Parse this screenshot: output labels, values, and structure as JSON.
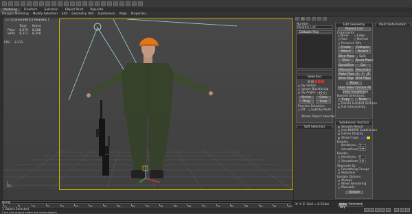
{
  "menubar": {
    "tabs": [
      "Modeling",
      "Freeform",
      "Selection",
      "Object Paint",
      "Populate"
    ],
    "active_tab": 0
  },
  "ribbon": {
    "items": [
      "Polygon Modeling",
      "Modify Selection",
      "Edit",
      "Geometry (All)",
      "Subdivision",
      "Align",
      "Properties"
    ]
  },
  "viewport": {
    "label": "[+] [Camera001] [ Realistic ]",
    "stats": {
      "headers": [
        "",
        "Total",
        "Name"
      ],
      "rows": [
        [
          "Polys",
          "8,670",
          "8,588"
        ],
        [
          "Verts",
          "8,311",
          "8,258"
        ]
      ]
    },
    "fps_label": "FPS:",
    "fps_value": "3.211"
  },
  "right_panel": {
    "tabs": [
      "Number",
      "Paint Deformation"
    ],
    "modifier_list_label": "Modifier List",
    "stack_item": "Editable Poly",
    "selection_title": "Selection",
    "by_vertex": "By Vertex",
    "ignore_backfacing": "Ignore Backfacing",
    "by_angle": "By Angle:",
    "by_angle_value": "45.0",
    "shrink": "Shrink",
    "grow": "Grow",
    "ring": "Ring",
    "loop": "Loop",
    "preview_selection": "Preview Selection",
    "off": "Off",
    "subobj": "SubObj",
    "multi": "Multi",
    "whole_object": "Whole Object Selected",
    "soft_selection": "Soft Selection",
    "edit_geometry": "Edit Geometry",
    "repeat_last": "Repeat Last",
    "constraints": "Constraints",
    "none": "None",
    "edge": "Edge",
    "face": "Face",
    "normal": "Normal",
    "preserve_uvs": "Preserve UVs",
    "create": "Create",
    "collapse": "Collapse",
    "attach": "Attach",
    "detach": "Detach",
    "slice_plane": "Slice Plane",
    "split": "Split",
    "slice": "Slice",
    "reset_plane": "Reset Plane",
    "quickslice": "QuickSlice",
    "cut": "Cut",
    "msmooth": "MSmooth",
    "tessellate": "Tessellate",
    "make_planar": "Make Planar",
    "x": "X",
    "y": "Y",
    "z": "Z",
    "view_align": "View Align",
    "grid_align": "Grid Align",
    "relax": "Relax",
    "hide_selected": "Hide Selected",
    "unhide_all": "Unhide All",
    "hide_unselected": "Hide Unselected",
    "named_selections": "Named Selections:",
    "copy": "Copy",
    "paste": "Paste",
    "delete_isolated": "Delete Isolated Vertices",
    "full_interactivity": "Full Interactivity",
    "subdivision_surface": "Subdivision Surface",
    "smooth_result": "Smooth Result",
    "use_nurms": "Use NURMS Subdivision",
    "isoline_display": "Isoline Display",
    "show_cage": "Show Cage......",
    "display": "Display",
    "iterations": "Iterations:",
    "iterations_value": "1",
    "smoothness": "Smoothness:",
    "smoothness_value": "1.0",
    "render": "Render",
    "render_iterations_value": "0",
    "render_smoothness_value": "1.0",
    "separate_by": "Separate By",
    "smoothing_groups": "Smoothing Groups",
    "materials": "Materials",
    "update_options": "Update Options",
    "always": "Always",
    "when_rendering": "When Rendering",
    "manually": "Manually",
    "update": "Update"
  },
  "timeline": {
    "slider_label": "0 / 100",
    "ticks": [
      "0",
      "5",
      "10",
      "15",
      "20",
      "25",
      "30",
      "35",
      "40",
      "45",
      "50",
      "55",
      "60",
      "65",
      "70",
      "75",
      "80",
      "85",
      "90",
      "95",
      "100"
    ],
    "status_selected": "1 Object Selected",
    "status_hint": "Click and drag to select and move objects",
    "coords": "X:     Y:     Z:     Grid = 0.254m",
    "auto_key": "Auto Key",
    "selected_label": "Selected"
  },
  "colors": {
    "viewport_border": "#c8b400",
    "swatch_blue": "#3f3fd8",
    "swatch_yellow": "#e8d200",
    "cap_orange": "#e0761e"
  }
}
